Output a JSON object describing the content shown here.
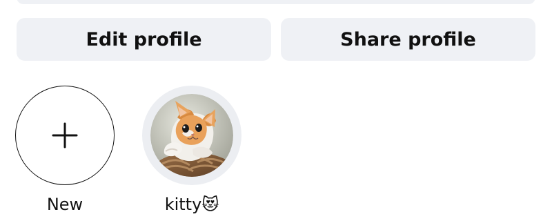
{
  "profile_actions": {
    "edit_label": "Edit profile",
    "share_label": "Share profile"
  },
  "highlights": {
    "new": {
      "label": "New",
      "icon": "plus-icon"
    },
    "items": [
      {
        "label": "kitty😻",
        "image": "orange-white-cat-in-basket"
      }
    ]
  },
  "colors": {
    "button_background": "#eff1f5",
    "text": "#111111",
    "ring": "#eceef2"
  }
}
